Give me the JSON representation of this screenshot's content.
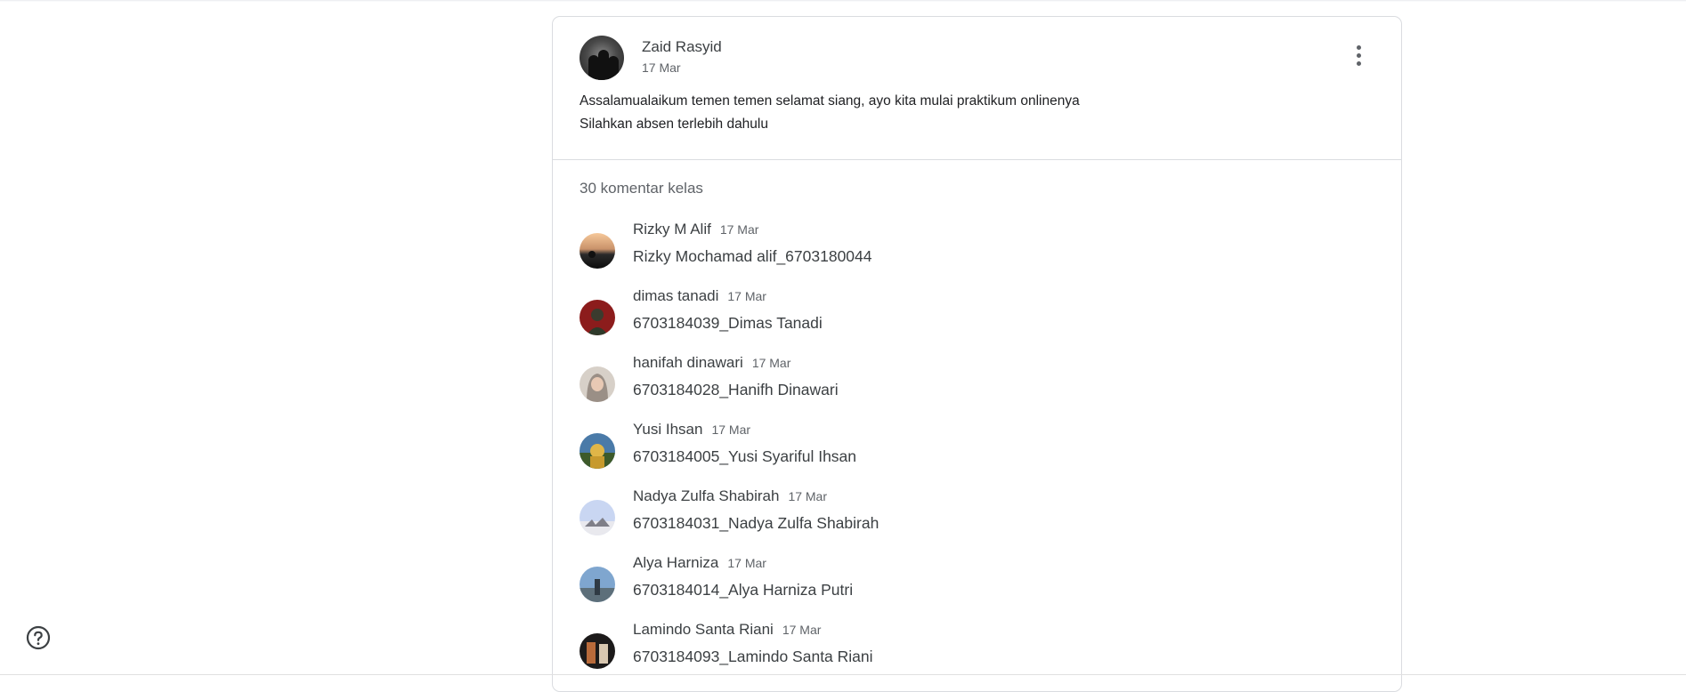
{
  "post": {
    "author": "Zaid Rasyid",
    "date": "17 Mar",
    "body_line1": "Assalamualaikum temen temen selamat siang, ayo kita mulai praktikum onlinenya",
    "body_line2": "Silahkan absen terlebih dahulu",
    "menu_icon": "more-vert-icon"
  },
  "comments_header": "30 komentar kelas",
  "comments": [
    {
      "name": "Rizky M Alif",
      "date": "17 Mar",
      "text": "Rizky Mochamad alif_6703180044"
    },
    {
      "name": "dimas tanadi",
      "date": "17 Mar",
      "text": "6703184039_Dimas Tanadi"
    },
    {
      "name": "hanifah dinawari",
      "date": "17 Mar",
      "text": "6703184028_Hanifh Dinawari"
    },
    {
      "name": "Yusi Ihsan",
      "date": "17 Mar",
      "text": "6703184005_Yusi Syariful Ihsan"
    },
    {
      "name": "Nadya Zulfa Shabirah",
      "date": "17 Mar",
      "text": "6703184031_Nadya Zulfa Shabirah"
    },
    {
      "name": "Alya Harniza",
      "date": "17 Mar",
      "text": "6703184014_Alya Harniza Putri"
    },
    {
      "name": "Lamindo Santa Riani",
      "date": "17 Mar",
      "text": "6703184093_Lamindo Santa Riani"
    }
  ],
  "help_icon": "help-circle-icon"
}
